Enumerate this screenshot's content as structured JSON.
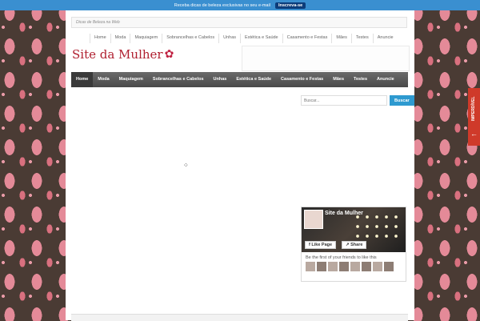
{
  "topbar": {
    "message": "Receba dicas de beleza exclusivas no seu e-mail",
    "subscribe_label": "Inscreva-se"
  },
  "header": {
    "tagline": "Dicas de Beleza na Web",
    "logo_text": "Site da Mulher",
    "logo_icon": "rose-flower-icon"
  },
  "top_nav": [
    "Home",
    "Moda",
    "Maquiagem",
    "Sobrancelhas e Cabelos",
    "Unhas",
    "Estética e Saúde",
    "Casamento e Festas",
    "Mães",
    "Testes",
    "Anuncie"
  ],
  "main_nav": [
    "Home",
    "Moda",
    "Maquiagem",
    "Sobrancelhas e Cabelos",
    "Unhas",
    "Estética e Saúde",
    "Casamento e Festas",
    "Mães",
    "Testes",
    "Anuncie"
  ],
  "search": {
    "placeholder": "Buscar...",
    "button_label": "Buscar"
  },
  "facebook_box": {
    "page_name": "Site da Mulher",
    "like_label": "Like Page",
    "share_label": "Share",
    "friends_text": "Be the first of your friends to like this"
  },
  "side_tab": {
    "label": "IMPERDÍVEL",
    "arrow_icon": "arrow-left-icon"
  },
  "colors": {
    "topbar": "#3a8fd0",
    "accent_button": "#2e9ad0",
    "side_tab": "#cf3a2a",
    "logo": "#b02030",
    "background_pink": "#e48a98",
    "background_brown": "#4a3b34"
  }
}
